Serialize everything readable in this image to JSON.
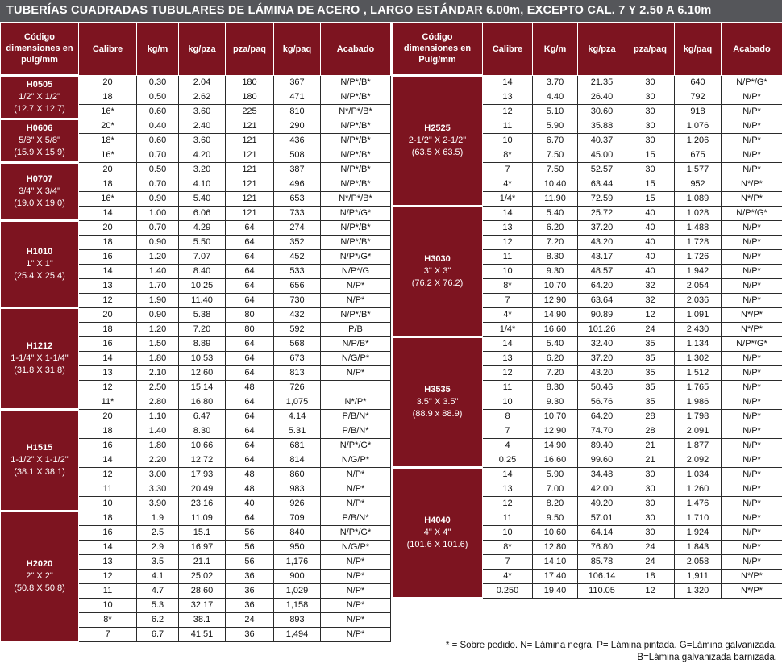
{
  "title": "TUBERÍAS CUADRADAS TUBULARES DE LÁMINA DE ACERO , LARGO ESTÁNDAR 6.00m, EXCEPTO CAL. 7 Y 2.50 A 6.10m",
  "colors": {
    "header_bg": "#7d1420",
    "title_bg": "#55565a"
  },
  "left_headers": [
    "Código dimensiones en pulg/mm",
    "Calibre",
    "kg/m",
    "kg/pza",
    "pza/paq",
    "kg/paq",
    "Acabado"
  ],
  "right_headers": [
    "Código dimensiones en Pulg/mm",
    "Calibre",
    "Kg/m",
    "kg/pza",
    "pza/paq",
    "kg/paq",
    "Acabado"
  ],
  "left_groups": [
    {
      "code": "H0505",
      "inch": "1/2\" X 1/2\"",
      "mm": "(12.7 X 12.7)",
      "rows": [
        [
          "20",
          "0.30",
          "2.04",
          "180",
          "367",
          "N/P*/B*"
        ],
        [
          "18",
          "0.50",
          "2.62",
          "180",
          "471",
          "N/P*/B*"
        ],
        [
          "16*",
          "0.60",
          "3.60",
          "225",
          "810",
          "N*/P*/B*"
        ]
      ]
    },
    {
      "code": "H0606",
      "inch": "5/8\" X 5/8\"",
      "mm": "(15.9 X 15.9)",
      "rows": [
        [
          "20*",
          "0.40",
          "2.40",
          "121",
          "290",
          "N/P*/B*"
        ],
        [
          "18*",
          "0.60",
          "3.60",
          "121",
          "436",
          "N/P*/B*"
        ],
        [
          "16*",
          "0.70",
          "4.20",
          "121",
          "508",
          "N/P*/B*"
        ]
      ]
    },
    {
      "code": "H0707",
      "inch": "3/4\" X 3/4\"",
      "mm": "(19.0 X 19.0)",
      "rows": [
        [
          "20",
          "0.50",
          "3.20",
          "121",
          "387",
          "N/P*/B*"
        ],
        [
          "18",
          "0.70",
          "4.10",
          "121",
          "496",
          "N/P*/B*"
        ],
        [
          "16*",
          "0.90",
          "5.40",
          "121",
          "653",
          "N*/P*/B*"
        ],
        [
          "14",
          "1.00",
          "6.06",
          "121",
          "733",
          "N/P*/G*"
        ]
      ]
    },
    {
      "code": "H1010",
      "inch": "1\" X 1\"",
      "mm": "(25.4 X 25.4)",
      "rows": [
        [
          "20",
          "0.70",
          "4.29",
          "64",
          "274",
          "N/P*/B*"
        ],
        [
          "18",
          "0.90",
          "5.50",
          "64",
          "352",
          "N/P*/B*"
        ],
        [
          "16",
          "1.20",
          "7.07",
          "64",
          "452",
          "N/P*/G*"
        ],
        [
          "14",
          "1.40",
          "8.40",
          "64",
          "533",
          "N/P*/G"
        ],
        [
          "13",
          "1.70",
          "10.25",
          "64",
          "656",
          "N/P*"
        ],
        [
          "12",
          "1.90",
          "11.40",
          "64",
          "730",
          "N/P*"
        ]
      ]
    },
    {
      "code": "H1212",
      "inch": "1-1/4\" X 1-1/4\"",
      "mm": "(31.8 X 31.8)",
      "rows": [
        [
          "20",
          "0.90",
          "5.38",
          "80",
          "432",
          "N/P*/B*"
        ],
        [
          "18",
          "1.20",
          "7.20",
          "80",
          "592",
          "P/B"
        ],
        [
          "16",
          "1.50",
          "8.89",
          "64",
          "568",
          "N/P/B*"
        ],
        [
          "14",
          "1.80",
          "10.53",
          "64",
          "673",
          "N/G/P*"
        ],
        [
          "13",
          "2.10",
          "12.60",
          "64",
          "813",
          "N/P*"
        ],
        [
          "12",
          "2.50",
          "15.14",
          "48",
          "726",
          ""
        ],
        [
          "11*",
          "2.80",
          "16.80",
          "64",
          "1,075",
          "N*/P*"
        ]
      ]
    },
    {
      "code": "H1515",
      "inch": "1-1/2\" X 1-1/2\"",
      "mm": "(38.1 X 38.1)",
      "rows": [
        [
          "20",
          "1.10",
          "6.47",
          "64",
          "4.14",
          "P/B/N*"
        ],
        [
          "18",
          "1.40",
          "8.30",
          "64",
          "5.31",
          "P/B/N*"
        ],
        [
          "16",
          "1.80",
          "10.66",
          "64",
          "681",
          "N/P*/G*"
        ],
        [
          "14",
          "2.20",
          "12.72",
          "64",
          "814",
          "N/G/P*"
        ],
        [
          "12",
          "3.00",
          "17.93",
          "48",
          "860",
          "N/P*"
        ],
        [
          "11",
          "3.30",
          "20.49",
          "48",
          "983",
          "N/P*"
        ],
        [
          "10",
          "3.90",
          "23.16",
          "40",
          "926",
          "N/P*"
        ]
      ]
    },
    {
      "code": "H2020",
      "inch": "2\" X 2\"",
      "mm": "(50.8 X 50.8)",
      "rows": [
        [
          "18",
          "1.9",
          "11.09",
          "64",
          "709",
          "P/B/N*"
        ],
        [
          "16",
          "2.5",
          "15.1",
          "56",
          "840",
          "N/P*/G*"
        ],
        [
          "14",
          "2.9",
          "16.97",
          "56",
          "950",
          "N/G/P*"
        ],
        [
          "13",
          "3.5",
          "21.1",
          "56",
          "1,176",
          "N/P*"
        ],
        [
          "12",
          "4.1",
          "25.02",
          "36",
          "900",
          "N/P*"
        ],
        [
          "11",
          "4.7",
          "28.60",
          "36",
          "1,029",
          "N/P*"
        ],
        [
          "10",
          "5.3",
          "32.17",
          "36",
          "1,158",
          "N/P*"
        ],
        [
          "8*",
          "6.2",
          "38.1",
          "24",
          "893",
          "N/P*"
        ],
        [
          "7",
          "6.7",
          "41.51",
          "36",
          "1,494",
          "N/P*"
        ]
      ]
    }
  ],
  "right_groups": [
    {
      "code": "H2525",
      "inch": "2-1/2\" X 2-1/2\"",
      "mm": "(63.5 X 63.5)",
      "rows": [
        [
          "14",
          "3.70",
          "21.35",
          "30",
          "640",
          "N/P*/G*"
        ],
        [
          "13",
          "4.40",
          "26.40",
          "30",
          "792",
          "N/P*"
        ],
        [
          "12",
          "5.10",
          "30.60",
          "30",
          "918",
          "N/P*"
        ],
        [
          "11",
          "5.90",
          "35.88",
          "30",
          "1,076",
          "N/P*"
        ],
        [
          "10",
          "6.70",
          "40.37",
          "30",
          "1,206",
          "N/P*"
        ],
        [
          "8*",
          "7.50",
          "45.00",
          "15",
          "675",
          "N/P*"
        ],
        [
          "7",
          "7.50",
          "52.57",
          "30",
          "1,577",
          "N/P*"
        ],
        [
          "4*",
          "10.40",
          "63.44",
          "15",
          "952",
          "N*/P*"
        ],
        [
          "1/4*",
          "11.90",
          "72.59",
          "15",
          "1,089",
          "N*/P*"
        ]
      ]
    },
    {
      "code": "H3030",
      "inch": "3\" X 3\"",
      "mm": "(76.2 X 76.2)",
      "rows": [
        [
          "14",
          "5.40",
          "25.72",
          "40",
          "1,028",
          "N/P*/G*"
        ],
        [
          "13",
          "6.20",
          "37.20",
          "40",
          "1,488",
          "N/P*"
        ],
        [
          "12",
          "7.20",
          "43.20",
          "40",
          "1,728",
          "N/P*"
        ],
        [
          "11",
          "8.30",
          "43.17",
          "40",
          "1,726",
          "N/P*"
        ],
        [
          "10",
          "9.30",
          "48.57",
          "40",
          "1,942",
          "N/P*"
        ],
        [
          "8*",
          "10.70",
          "64.20",
          "32",
          "2,054",
          "N/P*"
        ],
        [
          "7",
          "12.90",
          "63.64",
          "32",
          "2,036",
          "N/P*"
        ],
        [
          "4*",
          "14.90",
          "90.89",
          "12",
          "1,091",
          "N*/P*"
        ],
        [
          "1/4*",
          "16.60",
          "101.26",
          "24",
          "2,430",
          "N*/P*"
        ]
      ]
    },
    {
      "code": "H3535",
      "inch": "3.5\" X 3.5\"",
      "mm": "(88.9 x 88.9)",
      "rows": [
        [
          "14",
          "5.40",
          "32.40",
          "35",
          "1,134",
          "N/P*/G*"
        ],
        [
          "13",
          "6.20",
          "37.20",
          "35",
          "1,302",
          "N/P*"
        ],
        [
          "12",
          "7.20",
          "43.20",
          "35",
          "1,512",
          "N/P*"
        ],
        [
          "11",
          "8.30",
          "50.46",
          "35",
          "1,765",
          "N/P*"
        ],
        [
          "10",
          "9.30",
          "56.76",
          "35",
          "1,986",
          "N/P*"
        ],
        [
          "8",
          "10.70",
          "64.20",
          "28",
          "1,798",
          "N/P*"
        ],
        [
          "7",
          "12.90",
          "74.70",
          "28",
          "2,091",
          "N/P*"
        ],
        [
          "4",
          "14.90",
          "89.40",
          "21",
          "1,877",
          "N/P*"
        ],
        [
          "0.25",
          "16.60",
          "99.60",
          "21",
          "2,092",
          "N/P*"
        ]
      ]
    },
    {
      "code": "H4040",
      "inch": "4\" X 4\"",
      "mm": "(101.6 X 101.6)",
      "rows": [
        [
          "14",
          "5.90",
          "34.48",
          "30",
          "1,034",
          "N/P*"
        ],
        [
          "13",
          "7.00",
          "42.00",
          "30",
          "1,260",
          "N/P*"
        ],
        [
          "12",
          "8.20",
          "49.20",
          "30",
          "1,476",
          "N/P*"
        ],
        [
          "11",
          "9.50",
          "57.01",
          "30",
          "1,710",
          "N/P*"
        ],
        [
          "10",
          "10.60",
          "64.14",
          "30",
          "1,924",
          "N/P*"
        ],
        [
          "8*",
          "12.80",
          "76.80",
          "24",
          "1,843",
          "N/P*"
        ],
        [
          "7",
          "14.10",
          "85.78",
          "24",
          "2,058",
          "N/P*"
        ],
        [
          "4*",
          "17.40",
          "106.14",
          "18",
          "1,911",
          "N*/P*"
        ],
        [
          "0.250",
          "19.40",
          "110.05",
          "12",
          "1,320",
          "N*/P*"
        ]
      ]
    }
  ],
  "footnote": [
    "* = Sobre pedido. N= Lámina negra. P= Lámina pintada.  G=Lámina galvanizada.",
    "B=Lámina galvanizada barnizada."
  ]
}
